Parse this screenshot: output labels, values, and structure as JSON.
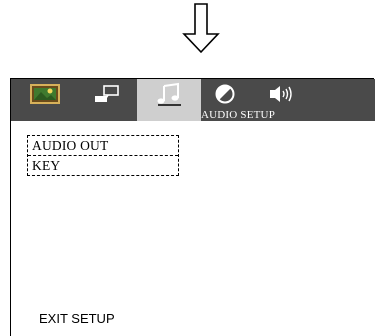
{
  "arrow": {
    "icon": "down-arrow-icon"
  },
  "tabs": [
    {
      "name": "general-setup",
      "icon": "picture-icon"
    },
    {
      "name": "video-setup",
      "icon": "display-speech-icon"
    },
    {
      "name": "audio-setup",
      "icon": "music-note-icon",
      "active": true
    },
    {
      "name": "preference",
      "icon": "contrast-circle-icon"
    },
    {
      "name": "speaker",
      "icon": "speaker-icon"
    }
  ],
  "section_label": "AUDIO SETUP",
  "menu": {
    "items": [
      {
        "label": "AUDIO OUT"
      },
      {
        "label": "KEY"
      }
    ]
  },
  "exit_label": "EXIT SETUP",
  "colors": {
    "tabbar": "#4a4a4a",
    "active_tab": "#cfcfcf"
  }
}
